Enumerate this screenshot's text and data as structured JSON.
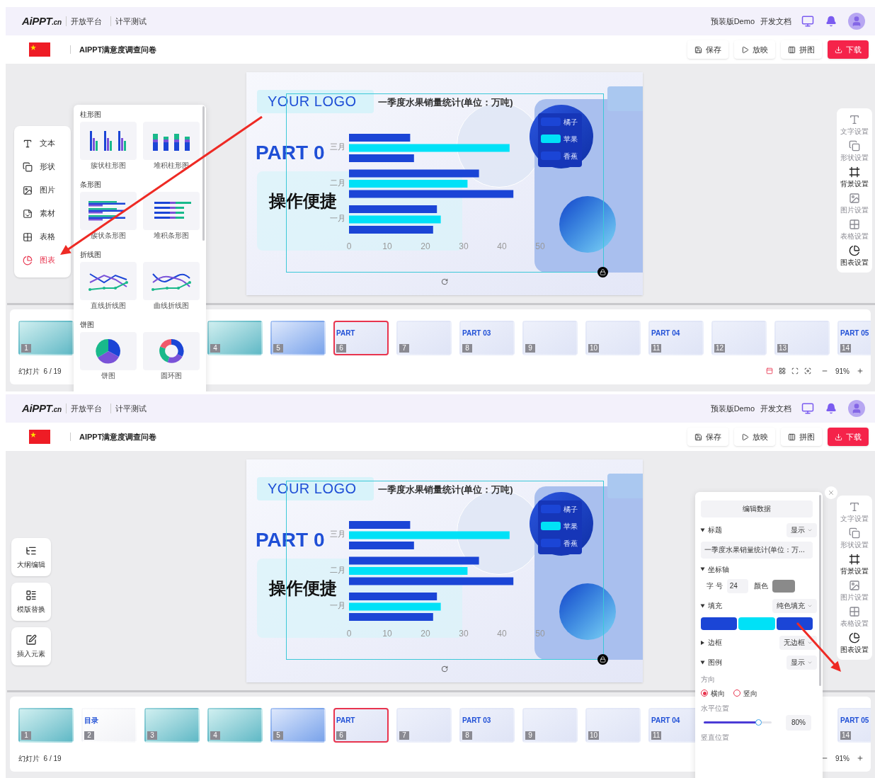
{
  "screens": [
    {
      "nav": {
        "logo": "AiPPT",
        "logo_suffix": ".cn",
        "links": [
          "开放平台",
          "计平测试"
        ],
        "right_links": [
          "预装版Demo",
          "开发文档"
        ]
      },
      "doc_title": "AIPPT满意度调查问卷",
      "actions": [
        {
          "label": "保存",
          "kind": "save",
          "primary": false
        },
        {
          "label": "放映",
          "kind": "play",
          "primary": false
        },
        {
          "label": "拼图",
          "kind": "collage",
          "primary": false
        },
        {
          "label": "下载",
          "kind": "download",
          "primary": true
        }
      ],
      "left": {
        "kind": "insert_menu",
        "items": [
          {
            "label": "文本",
            "selected": false
          },
          {
            "label": "形状",
            "selected": false
          },
          {
            "label": "图片",
            "selected": false
          },
          {
            "label": "素材",
            "selected": false
          },
          {
            "label": "表格",
            "selected": false
          },
          {
            "label": "图表",
            "selected": true
          }
        ],
        "chart_picker": [
          {
            "title": "柱形图",
            "options": [
              {
                "label": "簇状柱形图",
                "kind": "cluster_column"
              },
              {
                "label": "堆积柱形图",
                "kind": "stacked_column"
              }
            ]
          },
          {
            "title": "条形图",
            "options": [
              {
                "label": "簇状条形图",
                "kind": "cluster_bar"
              },
              {
                "label": "堆积条形图",
                "kind": "stacked_bar"
              }
            ]
          },
          {
            "title": "折线图",
            "options": [
              {
                "label": "直线折线图",
                "kind": "line"
              },
              {
                "label": "曲线折线图",
                "kind": "curve"
              }
            ]
          },
          {
            "title": "饼图",
            "options": [
              {
                "label": "饼图",
                "kind": "pie"
              },
              {
                "label": "圆环图",
                "kind": "donut"
              }
            ]
          }
        ]
      },
      "slide": {
        "logo": "YOUR LOGO",
        "heading": "PART 0",
        "subheading": "操作便捷",
        "chart_data": {
          "type": "bar",
          "orientation": "horizontal",
          "title": "一季度水果销量统计(单位：万吨)",
          "categories": [
            "三月",
            "二月",
            "一月"
          ],
          "series": [
            {
              "name": "橘子",
              "color": "#1b45d6",
              "values": [
                16,
                34,
                23
              ]
            },
            {
              "name": "苹果",
              "color": "#00e1f7",
              "values": [
                42,
                31,
                24
              ]
            },
            {
              "name": "香蕉",
              "color": "#1b45d6",
              "values": [
                17,
                43,
                22
              ]
            }
          ],
          "xlim": [
            0,
            50
          ],
          "xticks": [
            0,
            10,
            20,
            30,
            40,
            50
          ],
          "legend": "right"
        }
      },
      "right_tools": [
        {
          "label": "文字设置",
          "disabled": true
        },
        {
          "label": "形状设置",
          "disabled": true
        },
        {
          "label": "背景设置",
          "disabled": false
        },
        {
          "label": "图片设置",
          "disabled": true
        },
        {
          "label": "表格设置",
          "disabled": true
        },
        {
          "label": "图表设置",
          "disabled": false
        }
      ],
      "slides_label": "幻灯片  6 / 19",
      "thumbs": [
        {
          "kind": "teal",
          "number": "1",
          "selected": false
        },
        {
          "kind": "covered"
        },
        {
          "kind": "covered"
        },
        {
          "kind": "teal",
          "number": "4",
          "selected": false
        },
        {
          "kind": "blue",
          "number": "5",
          "selected": false
        },
        {
          "kind": "light",
          "number": "6",
          "title": "PART",
          "selected": true
        },
        {
          "kind": "light",
          "number": "7",
          "selected": false
        },
        {
          "kind": "light",
          "number": "8",
          "title": "PART 03",
          "selected": false
        },
        {
          "kind": "light",
          "number": "9",
          "selected": false
        },
        {
          "kind": "light",
          "number": "10",
          "selected": false
        },
        {
          "kind": "light",
          "number": "11",
          "title": "PART 04",
          "selected": false
        },
        {
          "kind": "light",
          "number": "12",
          "selected": false
        },
        {
          "kind": "light",
          "number": "13",
          "selected": false
        },
        {
          "kind": "light",
          "number": "14",
          "title": "PART 05",
          "selected": false
        }
      ],
      "view_buttons": true,
      "zoom": "91%",
      "arrow": true
    },
    {
      "nav": {
        "logo": "AiPPT",
        "logo_suffix": ".cn",
        "links": [
          "开放平台",
          "计平测试"
        ],
        "right_links": [
          "预装版Demo",
          "开发文档"
        ]
      },
      "doc_title": "AIPPT满意度调查问卷",
      "actions": [
        {
          "label": "保存",
          "kind": "save",
          "primary": false
        },
        {
          "label": "放映",
          "kind": "play",
          "primary": false
        },
        {
          "label": "拼图",
          "kind": "collage",
          "primary": false
        },
        {
          "label": "下载",
          "kind": "download",
          "primary": true
        }
      ],
      "left": {
        "kind": "tool_buttons",
        "items": [
          {
            "label": "大纲编辑"
          },
          {
            "label": "模版替换"
          },
          {
            "label": "插入元素"
          }
        ]
      },
      "slide": {
        "logo": "YOUR LOGO",
        "heading": "PART 0",
        "subheading": "操作便捷",
        "chart_data": {
          "type": "bar",
          "orientation": "horizontal",
          "title": "一季度水果销量统计(单位：万吨)",
          "categories": [
            "三月",
            "二月",
            "一月"
          ],
          "series": [
            {
              "name": "橘子",
              "color": "#1b45d6",
              "values": [
                16,
                34,
                23
              ]
            },
            {
              "name": "苹果",
              "color": "#00e1f7",
              "values": [
                42,
                31,
                24
              ]
            },
            {
              "name": "香蕉",
              "color": "#1b45d6",
              "values": [
                17,
                43,
                22
              ]
            }
          ],
          "xlim": [
            0,
            50
          ],
          "xticks": [
            0,
            10,
            20,
            30,
            40,
            50
          ],
          "legend": "right"
        }
      },
      "right_tools": [
        {
          "label": "文字设置",
          "disabled": true
        },
        {
          "label": "形状设置",
          "disabled": true
        },
        {
          "label": "背景设置",
          "disabled": false
        },
        {
          "label": "图片设置",
          "disabled": true
        },
        {
          "label": "表格设置",
          "disabled": true
        },
        {
          "label": "图表设置",
          "disabled": false
        }
      ],
      "settings_panel": {
        "edit_button": "编辑数据",
        "sections": [
          {
            "kind": "title",
            "label": "标题",
            "expanded": true,
            "dropdown": "显示",
            "value": "一季度水果销量统计(单位：万..."
          },
          {
            "kind": "axis",
            "label": "坐标轴",
            "expanded": true,
            "size_label": "字 号",
            "size": "24",
            "color_label": "颜色",
            "color": "#8a8a8a"
          },
          {
            "kind": "fill",
            "label": "填充",
            "expanded": true,
            "dropdown": "纯色填充",
            "swatches": [
              {
                "color": "#1b45d6"
              },
              {
                "color": "#00e1f7"
              },
              {
                "color": "#1b45d6"
              }
            ]
          },
          {
            "kind": "border",
            "label": "边框",
            "expanded": false,
            "dropdown": "无边框"
          },
          {
            "kind": "legend",
            "label": "图例",
            "expanded": true,
            "dropdown": "显示",
            "direction_label": "方向",
            "options": [
              {
                "label": "横向",
                "selected": true
              },
              {
                "label": "竖向",
                "selected": false
              }
            ],
            "h_label": "水平位置",
            "slider": {
              "level": 0.8,
              "reading": "80%"
            },
            "v_label": "竖直位置"
          }
        ]
      },
      "slides_label": "幻灯片  6 / 19",
      "thumbs": [
        {
          "kind": "teal",
          "number": "1",
          "selected": false
        },
        {
          "kind": "white",
          "number": "2",
          "title": "目录",
          "selected": false
        },
        {
          "kind": "teal",
          "number": "3",
          "selected": false
        },
        {
          "kind": "teal",
          "number": "4",
          "selected": false
        },
        {
          "kind": "blue",
          "number": "5",
          "selected": false
        },
        {
          "kind": "light",
          "number": "6",
          "title": "PART",
          "selected": true
        },
        {
          "kind": "light",
          "number": "7",
          "selected": false
        },
        {
          "kind": "light",
          "number": "8",
          "title": "PART 03",
          "selected": false
        },
        {
          "kind": "light",
          "number": "9",
          "selected": false
        },
        {
          "kind": "light",
          "number": "10",
          "selected": false
        },
        {
          "kind": "light",
          "number": "11",
          "title": "PART 04",
          "selected": false
        },
        {
          "kind": "covered"
        },
        {
          "kind": "covered"
        },
        {
          "kind": "light",
          "number": "14",
          "title": "PART 05",
          "selected": false
        }
      ],
      "view_buttons": false,
      "zoom": "91%",
      "arrow": true
    }
  ]
}
